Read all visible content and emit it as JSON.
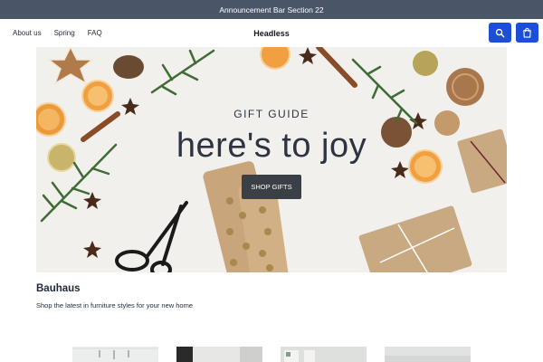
{
  "announcement": {
    "text": "Announcement Bar Section 22"
  },
  "header": {
    "nav": [
      {
        "label": "About us"
      },
      {
        "label": "Spring"
      },
      {
        "label": "FAQ"
      }
    ],
    "brand": "Headless",
    "search_icon": "search-icon",
    "cart_icon": "shopping-bag-icon"
  },
  "hero": {
    "eyebrow": "GIFT GUIDE",
    "title": "here's to joy",
    "cta_label": "SHOP GIFTS"
  },
  "collection": {
    "title": "Bauhaus",
    "subtitle": "Shop the latest in furniture styles for your new home"
  },
  "colors": {
    "announcement_bg": "#4a5568",
    "accent": "#1d4ed8",
    "cta_bg": "#3b3f46",
    "hero_bg": "#f1f0ec"
  }
}
